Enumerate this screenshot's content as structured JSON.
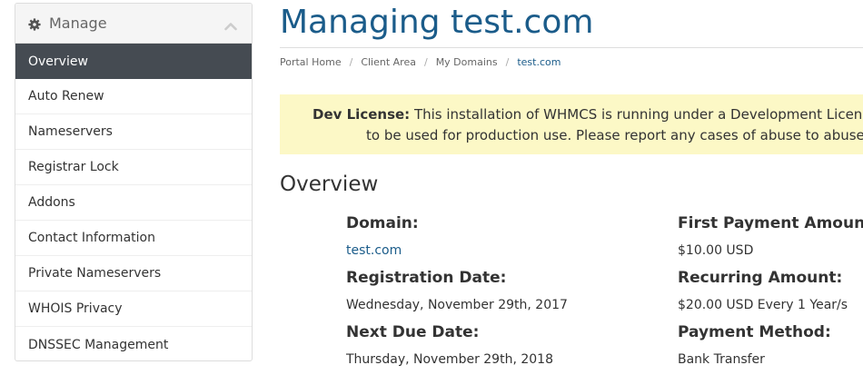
{
  "sidebar": {
    "title": "Manage",
    "items": [
      {
        "label": "Overview",
        "active": true
      },
      {
        "label": "Auto Renew"
      },
      {
        "label": "Nameservers"
      },
      {
        "label": "Registrar Lock"
      },
      {
        "label": "Addons"
      },
      {
        "label": "Contact Information"
      },
      {
        "label": "Private Nameservers"
      },
      {
        "label": "WHOIS Privacy"
      },
      {
        "label": "DNSSEC Management"
      }
    ]
  },
  "header": {
    "title": "Managing test.com",
    "breadcrumb": [
      "Portal Home",
      "Client Area",
      "My Domains",
      "test.com"
    ]
  },
  "alert": {
    "strong": "Dev License:",
    "line1": " This installation of WHMCS is running under a Development License",
    "line2": "to be used for production use. Please report any cases of abuse to abuse"
  },
  "overview": {
    "title": "Overview",
    "domain_label": "Domain:",
    "domain_value": "test.com",
    "registration_label": "Registration Date:",
    "registration_value": "Wednesday, November 29th, 2017",
    "next_due_label": "Next Due Date:",
    "next_due_value": "Thursday, November 29th, 2018",
    "first_payment_label": "First Payment Amount:",
    "first_payment_value": "$10.00 USD",
    "recurring_label": "Recurring Amount:",
    "recurring_value": "$20.00 USD Every 1 Year/s",
    "payment_method_label": "Payment Method:",
    "payment_method_value": "Bank Transfer"
  },
  "colors": {
    "accent": "#1b5c8a",
    "active_nav": "#454b52",
    "alert_bg": "#fcf8c6"
  }
}
